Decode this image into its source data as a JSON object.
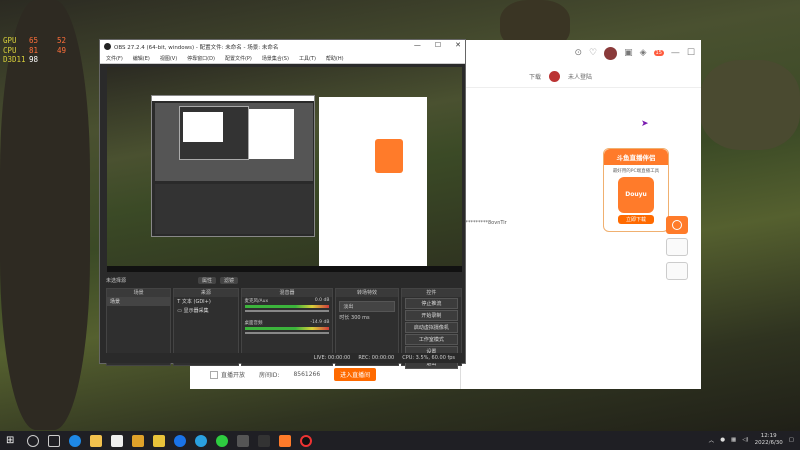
{
  "hud": {
    "gpu_label": "GPU",
    "gpu_temp": "65",
    "gpu_load": "52",
    "cpu_label": "CPU",
    "cpu_temp": "81",
    "cpu_load": "49",
    "api_label": "D3D11",
    "fps": "98"
  },
  "browser": {
    "download_label": "下载",
    "user_label": "未人登陆",
    "promo_title": "斗鱼直播伴侣",
    "promo_desc": "最好用的PC端直播工具",
    "promo_logo": "Douyu",
    "promo_download": "立即下载",
    "masked_text": "**********8ovnTir",
    "room_label": "房间ID:",
    "room_id": "8561266",
    "live_checkbox": "直播开放",
    "enter_button": "进入直播间"
  },
  "obs": {
    "window_title": "OBS 27.2.4 (64-bit, windows) - 配置文件: 未命名 - 场景: 未命名",
    "menu": [
      "文件(F)",
      "编辑(E)",
      "视图(V)",
      "停靠窗口(D)",
      "配置文件(P)",
      "场景集合(S)",
      "工具(T)",
      "帮助(H)"
    ],
    "scene_bar_label": "未选择源",
    "scene_bar_props": "属性",
    "scene_bar_filters": "滤镜",
    "docks": {
      "scenes": "场景",
      "sources": "来源",
      "mixer": "混音器",
      "transitions": "转场特效",
      "controls": "控件"
    },
    "scene_items": [
      "场景"
    ],
    "source_items": [
      "文本 (GDI+)",
      "显示器采集"
    ],
    "mixer_tracks": [
      {
        "name": "麦克风/Aux",
        "db": "0.0 dB"
      },
      {
        "name": "桌面音频",
        "db": "-14.9 dB"
      }
    ],
    "transition_type": "淡出",
    "transition_duration_label": "时长",
    "transition_duration": "300 ms",
    "control_buttons": [
      "停止推流",
      "开始录制",
      "启动虚拟摄像机",
      "工作室模式",
      "设置",
      "退出"
    ],
    "status": {
      "live": "LIVE: 00:00:00",
      "rec": "REC: 00:00:00",
      "cpu": "CPU: 3.5%, 60.00 fps"
    }
  },
  "taskbar": {
    "time": "12:19",
    "date": "2022/6/30"
  }
}
